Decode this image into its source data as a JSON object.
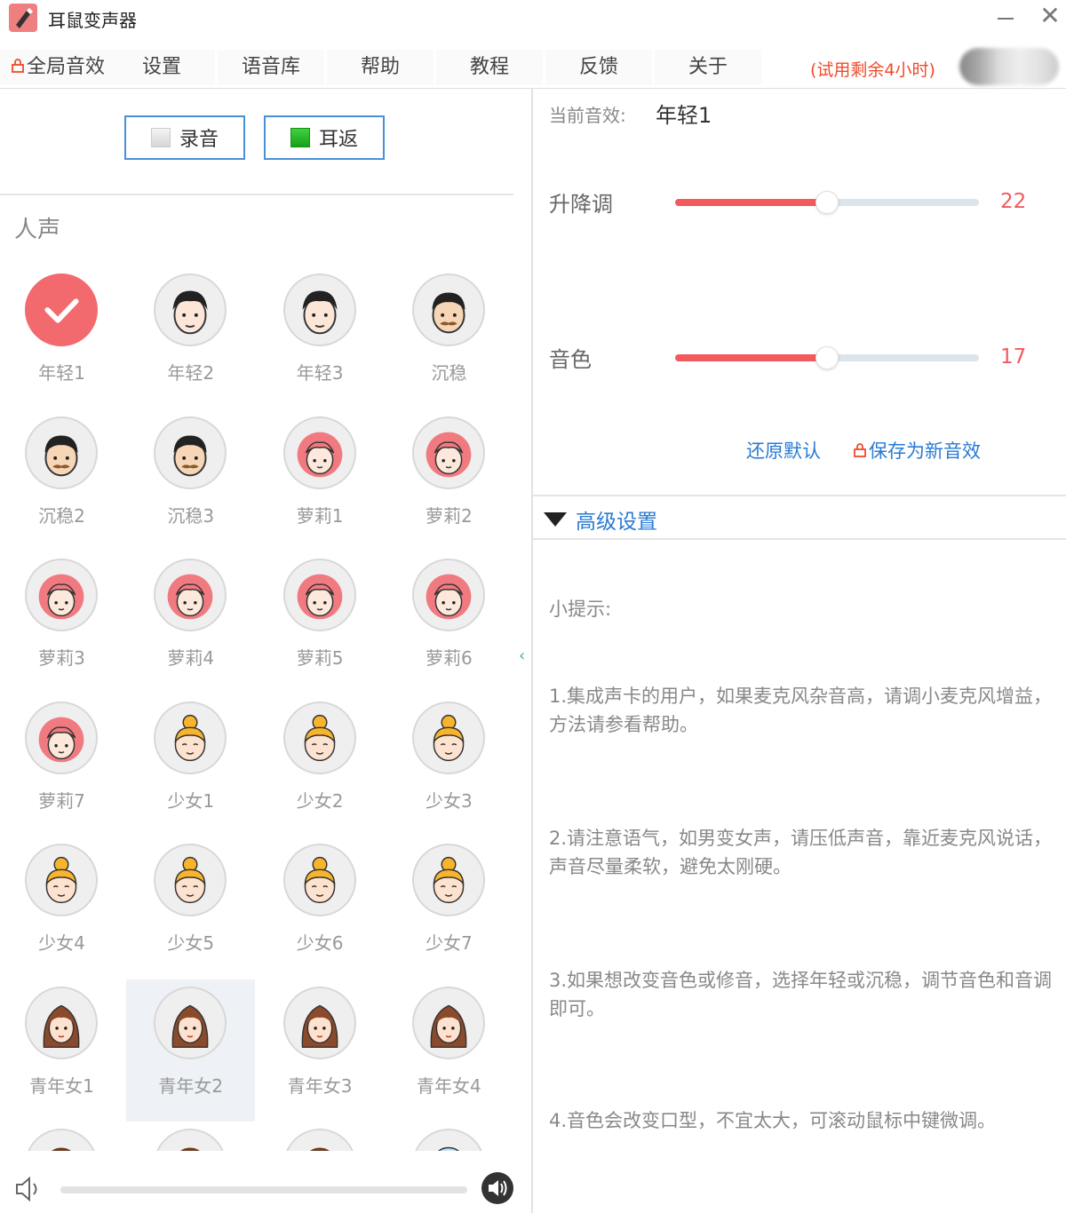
{
  "app": {
    "title": "耳鼠变声器"
  },
  "window": {
    "minimize_icon": "minimize-icon",
    "close_glyph": "✕"
  },
  "menu": {
    "items": [
      "全局音效",
      "设置",
      "语音库",
      "帮助",
      "教程",
      "反馈",
      "关于"
    ],
    "trial": "(试用剩余4小时)"
  },
  "controls": {
    "record_label": "录音",
    "monitor_label": "耳返"
  },
  "section_title": "人声",
  "voices": [
    {
      "label": "年轻1",
      "type": "young",
      "selected": true
    },
    {
      "label": "年轻2",
      "type": "young"
    },
    {
      "label": "年轻3",
      "type": "young"
    },
    {
      "label": "沉稳",
      "type": "mature"
    },
    {
      "label": "沉稳2",
      "type": "mature"
    },
    {
      "label": "沉稳3",
      "type": "mature"
    },
    {
      "label": "萝莉1",
      "type": "loli"
    },
    {
      "label": "萝莉2",
      "type": "loli"
    },
    {
      "label": "萝莉3",
      "type": "loli"
    },
    {
      "label": "萝莉4",
      "type": "loli"
    },
    {
      "label": "萝莉5",
      "type": "loli"
    },
    {
      "label": "萝莉6",
      "type": "loli"
    },
    {
      "label": "萝莉7",
      "type": "loli"
    },
    {
      "label": "少女1",
      "type": "girl"
    },
    {
      "label": "少女2",
      "type": "girl"
    },
    {
      "label": "少女3",
      "type": "girl"
    },
    {
      "label": "少女4",
      "type": "girl"
    },
    {
      "label": "少女5",
      "type": "girl"
    },
    {
      "label": "少女6",
      "type": "girl"
    },
    {
      "label": "少女7",
      "type": "girl"
    },
    {
      "label": "青年女1",
      "type": "woman"
    },
    {
      "label": "青年女2",
      "type": "woman",
      "hover": true
    },
    {
      "label": "青年女3",
      "type": "woman"
    },
    {
      "label": "青年女4",
      "type": "woman"
    },
    {
      "label": "",
      "type": "brown"
    },
    {
      "label": "",
      "type": "brown"
    },
    {
      "label": "",
      "type": "brown"
    },
    {
      "label": "",
      "type": "blue"
    }
  ],
  "current": {
    "label": "当前音效:",
    "value": "年轻1"
  },
  "sliders": [
    {
      "label": "升降调",
      "value": "22",
      "fraction": 0.5
    },
    {
      "label": "音色",
      "value": "17",
      "fraction": 0.5
    }
  ],
  "actions": {
    "reset": "还原默认",
    "save": "保存为新音效"
  },
  "advanced": {
    "label": "高级设置"
  },
  "tips": {
    "title": "小提示:",
    "items": [
      "1.集成声卡的用户，如果麦克风杂音高，请调小麦克风增益，方法请参看帮助。",
      "2.请注意语气，如男变女声，请压低声音，靠近麦克风说话，声音尽量柔软，避免太刚硬。",
      "3.如果想改变音色或修音，选择年轻或沉稳，调节音色和音调即可。",
      "4.音色会改变口型，不宜太大，可滚动鼠标中键微调。"
    ]
  },
  "volume": {
    "level": 0.0
  },
  "colors": {
    "accent": "#f25a5e",
    "link": "#2a7bd3",
    "trial": "#f04a2a"
  }
}
